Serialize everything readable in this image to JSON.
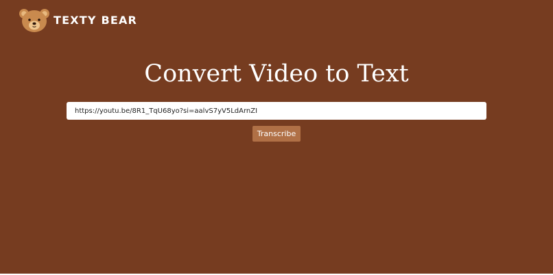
{
  "brand": {
    "name": "TEXTY BEAR",
    "logo_icon": "teddy-bear-icon"
  },
  "main": {
    "title": "Convert Video to Text",
    "url_input": {
      "value": "https://youtu.be/8R1_TqU68yo?si=aalvS7yV5LdArnZI"
    },
    "transcribe_label": "Transcribe"
  },
  "colors": {
    "background": "#763c20",
    "button": "#b07046",
    "text": "#ffffff"
  }
}
